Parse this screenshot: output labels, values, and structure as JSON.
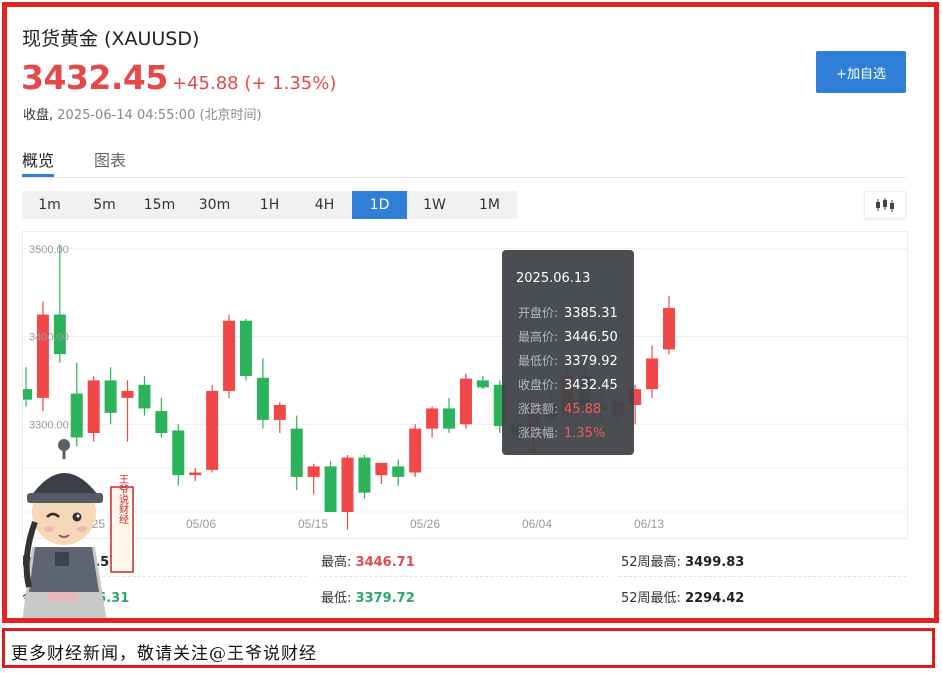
{
  "header": {
    "title": "现货黄金  (XAUUSD)",
    "price": "3432.45",
    "change": "+45.88 (+ 1.35%)",
    "status_label": "收盘,",
    "status_time": "2025-06-14 04:55:00 (北京时间)",
    "add_watchlist_label": "+加自选"
  },
  "tabs": [
    "概览",
    "图表"
  ],
  "intervals": {
    "items": [
      "1m",
      "5m",
      "15m",
      "30m",
      "1H",
      "4H",
      "1D",
      "1W",
      "1M"
    ],
    "active": "1D"
  },
  "chart_data": {
    "type": "candlestick",
    "ylim": [
      3200,
      3510
    ],
    "y_ticks": [
      "3500.00",
      "3400.00",
      "3300.00"
    ],
    "x_ticks": [
      "04/25",
      "05/06",
      "05/15",
      "05/26",
      "06/04",
      "06/13"
    ],
    "up_color": "#f04848",
    "down_color": "#2bb35a",
    "candles": [
      {
        "o": 3340,
        "h": 3365,
        "l": 3320,
        "c": 3328
      },
      {
        "o": 3330,
        "h": 3440,
        "l": 3315,
        "c": 3425
      },
      {
        "o": 3425,
        "h": 3505,
        "l": 3370,
        "c": 3380
      },
      {
        "o": 3335,
        "h": 3370,
        "l": 3275,
        "c": 3285
      },
      {
        "o": 3290,
        "h": 3355,
        "l": 3280,
        "c": 3350
      },
      {
        "o": 3350,
        "h": 3365,
        "l": 3300,
        "c": 3313
      },
      {
        "o": 3330,
        "h": 3350,
        "l": 3280,
        "c": 3338
      },
      {
        "o": 3345,
        "h": 3355,
        "l": 3310,
        "c": 3318
      },
      {
        "o": 3315,
        "h": 3330,
        "l": 3285,
        "c": 3290
      },
      {
        "o": 3293,
        "h": 3300,
        "l": 3230,
        "c": 3242
      },
      {
        "o": 3242,
        "h": 3250,
        "l": 3235,
        "c": 3245
      },
      {
        "o": 3248,
        "h": 3345,
        "l": 3245,
        "c": 3338
      },
      {
        "o": 3338,
        "h": 3425,
        "l": 3330,
        "c": 3418
      },
      {
        "o": 3418,
        "h": 3420,
        "l": 3350,
        "c": 3355
      },
      {
        "o": 3353,
        "h": 3375,
        "l": 3295,
        "c": 3305
      },
      {
        "o": 3305,
        "h": 3325,
        "l": 3290,
        "c": 3322
      },
      {
        "o": 3295,
        "h": 3310,
        "l": 3225,
        "c": 3240
      },
      {
        "o": 3240,
        "h": 3255,
        "l": 3220,
        "c": 3252
      },
      {
        "o": 3252,
        "h": 3258,
        "l": 3200,
        "c": 3200
      },
      {
        "o": 3200,
        "h": 3265,
        "l": 3180,
        "c": 3262
      },
      {
        "o": 3262,
        "h": 3265,
        "l": 3215,
        "c": 3222
      },
      {
        "o": 3242,
        "h": 3255,
        "l": 3232,
        "c": 3256
      },
      {
        "o": 3252,
        "h": 3260,
        "l": 3230,
        "c": 3240
      },
      {
        "o": 3245,
        "h": 3300,
        "l": 3240,
        "c": 3295
      },
      {
        "o": 3295,
        "h": 3320,
        "l": 3285,
        "c": 3318
      },
      {
        "o": 3318,
        "h": 3330,
        "l": 3290,
        "c": 3295
      },
      {
        "o": 3300,
        "h": 3358,
        "l": 3295,
        "c": 3352
      },
      {
        "o": 3350,
        "h": 3355,
        "l": 3340,
        "c": 3342
      },
      {
        "o": 3345,
        "h": 3350,
        "l": 3290,
        "c": 3298
      },
      {
        "o": 3300,
        "h": 3315,
        "l": 3285,
        "c": 3288
      },
      {
        "o": 3288,
        "h": 3325,
        "l": 3265,
        "c": 3320
      },
      {
        "o": 3322,
        "h": 3340,
        "l": 3300,
        "c": 3305
      },
      {
        "o": 3312,
        "h": 3370,
        "l": 3305,
        "c": 3355
      },
      {
        "o": 3355,
        "h": 3365,
        "l": 3315,
        "c": 3322
      },
      {
        "o": 3322,
        "h": 3340,
        "l": 3300,
        "c": 3316
      },
      {
        "o": 3310,
        "h": 3328,
        "l": 3302,
        "c": 3326
      },
      {
        "o": 3322,
        "h": 3345,
        "l": 3300,
        "c": 3340
      },
      {
        "o": 3340,
        "h": 3390,
        "l": 3330,
        "c": 3375
      },
      {
        "o": 3385.31,
        "h": 3446.5,
        "l": 3379.92,
        "c": 3432.45
      }
    ]
  },
  "tooltip": {
    "date": "2025.06.13",
    "rows": [
      {
        "label": "开盘价:",
        "value": "3385.31"
      },
      {
        "label": "最高价:",
        "value": "3446.50"
      },
      {
        "label": "最低价:",
        "value": "3379.92"
      },
      {
        "label": "收盘价:",
        "value": "3432.45"
      },
      {
        "label": "涨跌额:",
        "value": "45.88"
      },
      {
        "label": "涨跌幅:",
        "value": "1.35%"
      }
    ]
  },
  "stats": {
    "prev_close_label": "昨",
    "prev_close": "86.57",
    "open_label": "今",
    "open": "385.31",
    "high_label": "最高:",
    "high": "3446.71",
    "low_label": "最低:",
    "low": "3379.72",
    "w52_high_label": "52周最高:",
    "w52_high": "3499.83",
    "w52_low_label": "52周最低:",
    "w52_low": "2294.42"
  },
  "mascot_seal_text": "王爷说财经",
  "footer_text": "更多财经新闻，敬请关注@王爷说财经",
  "colors": {
    "frame_red": "#e32222",
    "accent_blue": "#2f7fd6",
    "price_red": "#e54a4a"
  }
}
